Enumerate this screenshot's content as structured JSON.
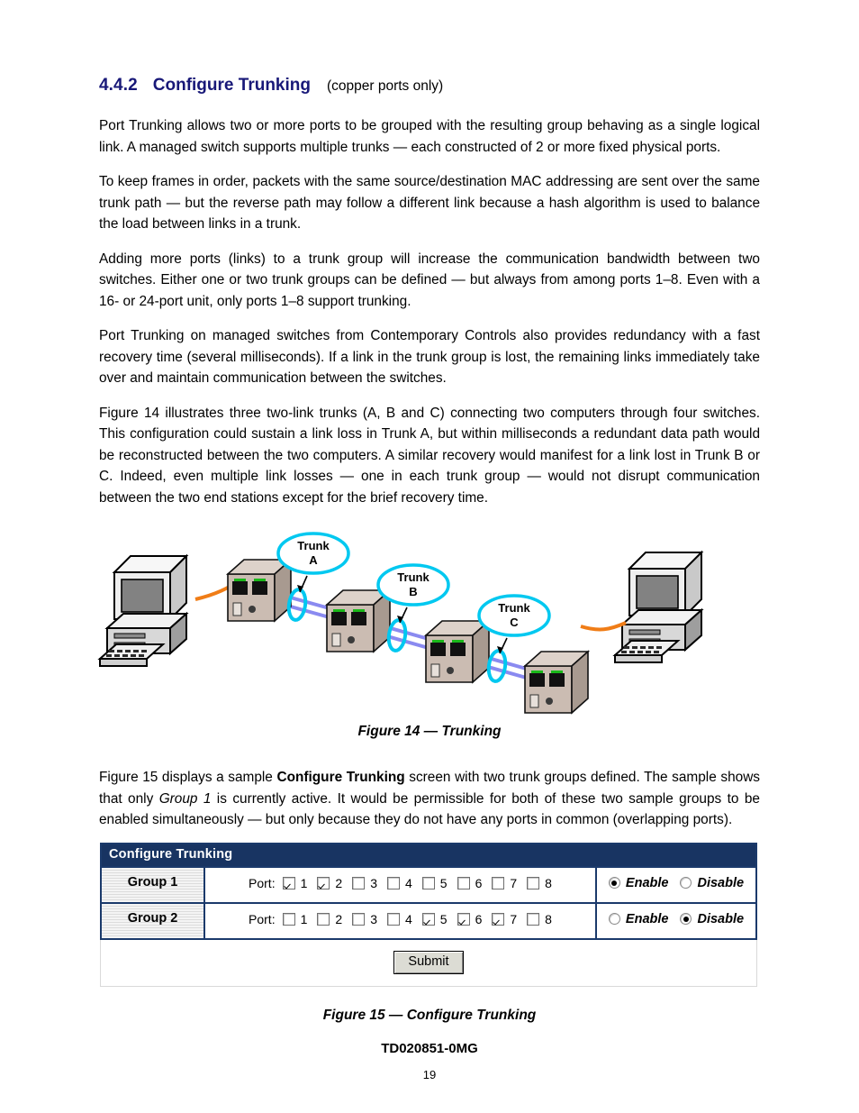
{
  "heading": {
    "number": "4.4.2",
    "title": "Configure Trunking",
    "subtitle": "(copper ports only)"
  },
  "paragraphs": [
    "Port Trunking allows two or more ports to be grouped with the resulting group behaving as a single logical link.  A managed switch supports multiple trunks — each constructed of 2 or more fixed physical ports.",
    "To keep frames in order, packets with the same source/destination MAC addressing are sent over the same trunk path — but the reverse path may follow a different link because a hash algorithm is used to balance the load between links in a trunk.",
    "Adding more ports (links) to a trunk group will increase the communication bandwidth between two switches.  Either one or two trunk groups can be defined — but always from among ports 1–8.  Even with a 16- or 24-port unit, only ports 1–8 support trunking.",
    "Port Trunking on managed switches from Contemporary Controls also provides redundancy with a fast recovery time (several milliseconds).  If a link in the trunk group is lost, the remaining links immediately take over and maintain communication between the switches.",
    "Figure 14 illustrates three two-link trunks (A, B and C) connecting two computers through four switches.  This configuration could sustain a link loss in Trunk A, but within milliseconds a redundant data path would be reconstructed between the two computers.  A similar recovery would manifest for a link lost in Trunk B or C.  Indeed, even multiple link losses — one in each trunk group — would not disrupt communication between the two end stations except for the brief recovery time."
  ],
  "figure14": {
    "caption": "Figure 14 — Trunking",
    "trunk_labels": [
      {
        "name": "Trunk",
        "id": "A"
      },
      {
        "name": "Trunk",
        "id": "B"
      },
      {
        "name": "Trunk",
        "id": "C"
      }
    ],
    "node_count": {
      "computers": 2,
      "switches": 4
    },
    "colors": {
      "trunk_ellipse": "#00c8f0",
      "trunk_link": "#8080f0",
      "end_link": "#f07d17",
      "switch_body": "#c2b2a8",
      "computer_body": "#808080"
    }
  },
  "paragraph_after_figure": "Figure 15 displays a sample Configure Trunking screen with two trunk groups defined. The sample shows that only Group 1 is currently active.   It would be permissible for both of these two sample groups to be enabled simultaneously — but only because they do not have any ports in common (overlapping ports).",
  "paragraph_after_figure_parts": {
    "a": "Figure 15 displays a sample ",
    "bold1": "Configure Trunking",
    "b": " screen with two trunk groups defined. The sample shows that only ",
    "italic1": "Group 1",
    "c": " is currently active.   It would be permissible for both of these two sample groups to be enabled simultaneously — but only because they do not have any ports in common (overlapping ports)."
  },
  "configure_trunking": {
    "panel_title": "Configure Trunking",
    "ports_label": "Port:",
    "port_numbers": [
      "1",
      "2",
      "3",
      "4",
      "5",
      "6",
      "7",
      "8"
    ],
    "enable_label": "Enable",
    "disable_label": "Disable",
    "submit_label": "Submit",
    "colors": {
      "titlebar_bg": "#183462",
      "border": "#1b3a6b",
      "group_cell_bg": "#f0f0f0",
      "button_face": "#dcdcd4"
    },
    "rows": [
      {
        "group_label": "Group 1",
        "ports_checked": [
          true,
          true,
          false,
          false,
          false,
          false,
          false,
          false
        ],
        "state": "Enable"
      },
      {
        "group_label": "Group 2",
        "ports_checked": [
          false,
          false,
          false,
          false,
          true,
          true,
          true,
          false
        ],
        "state": "Disable"
      }
    ]
  },
  "figure15": {
    "caption": "Figure 15 — Configure Trunking"
  },
  "footer": {
    "doc_id": "TD020851-0MG",
    "page_number": "19"
  }
}
